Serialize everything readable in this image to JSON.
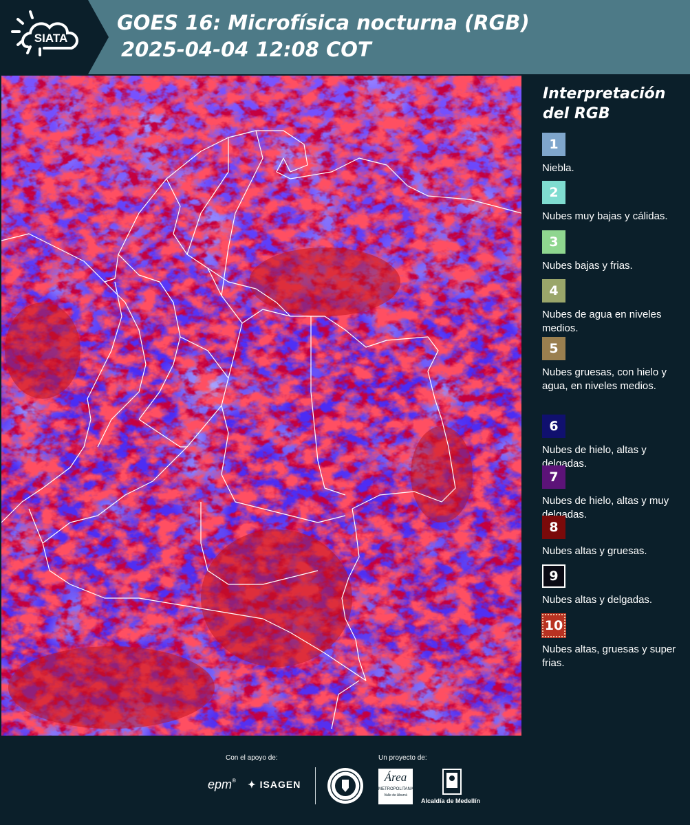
{
  "header": {
    "logo_text": "SIATA",
    "title_line1": "GOES 16: Microfísica nocturna (RGB)",
    "title_line2": "2025-04-04 12:08 COT",
    "background_color": "#4d7a87"
  },
  "legend": {
    "title_line1": "Interpretación",
    "title_line2": "del RGB",
    "items": [
      {
        "number": "1",
        "label": "Niebla.",
        "color": "#7fa6cc"
      },
      {
        "number": "2",
        "label": "Nubes muy bajas y cálidas.",
        "color": "#7fdcd0"
      },
      {
        "number": "3",
        "label": "Nubes bajas y frias.",
        "color": "#8fd68f"
      },
      {
        "number": "4",
        "label": "Nubes de agua en niveles medios.",
        "color": "#9aa66a"
      },
      {
        "number": "5",
        "label": "Nubes gruesas, con hielo y agua, en niveles medios.",
        "color": "#9a7f4f"
      },
      {
        "number": "6",
        "label": "Nubes de hielo, altas y delgadas.",
        "color": "#10106e"
      },
      {
        "number": "7",
        "label": "Nubes de hielo, altas y muy delgadas.",
        "color": "#5c1378"
      },
      {
        "number": "8",
        "label": "Nubes altas y gruesas.",
        "color": "#7a0a0a"
      },
      {
        "number": "9",
        "label": "Nubes altas y delgadas.",
        "color": "#0a0a14"
      },
      {
        "number": "10",
        "label": "Nubes altas, gruesas y super frias.",
        "color": "#b83222"
      }
    ]
  },
  "footer": {
    "support_label": "Con el apoyo de:",
    "project_label": "Un proyecto de:",
    "sponsor_epm": "epm",
    "sponsor_isagen": "ISAGEN",
    "partner_area_line1": "Área",
    "partner_area_line2": "METROPOLITANA",
    "partner_area_line3": "Valle de Aburrá",
    "partner_medellin": "Alcaldía de Medellín"
  }
}
